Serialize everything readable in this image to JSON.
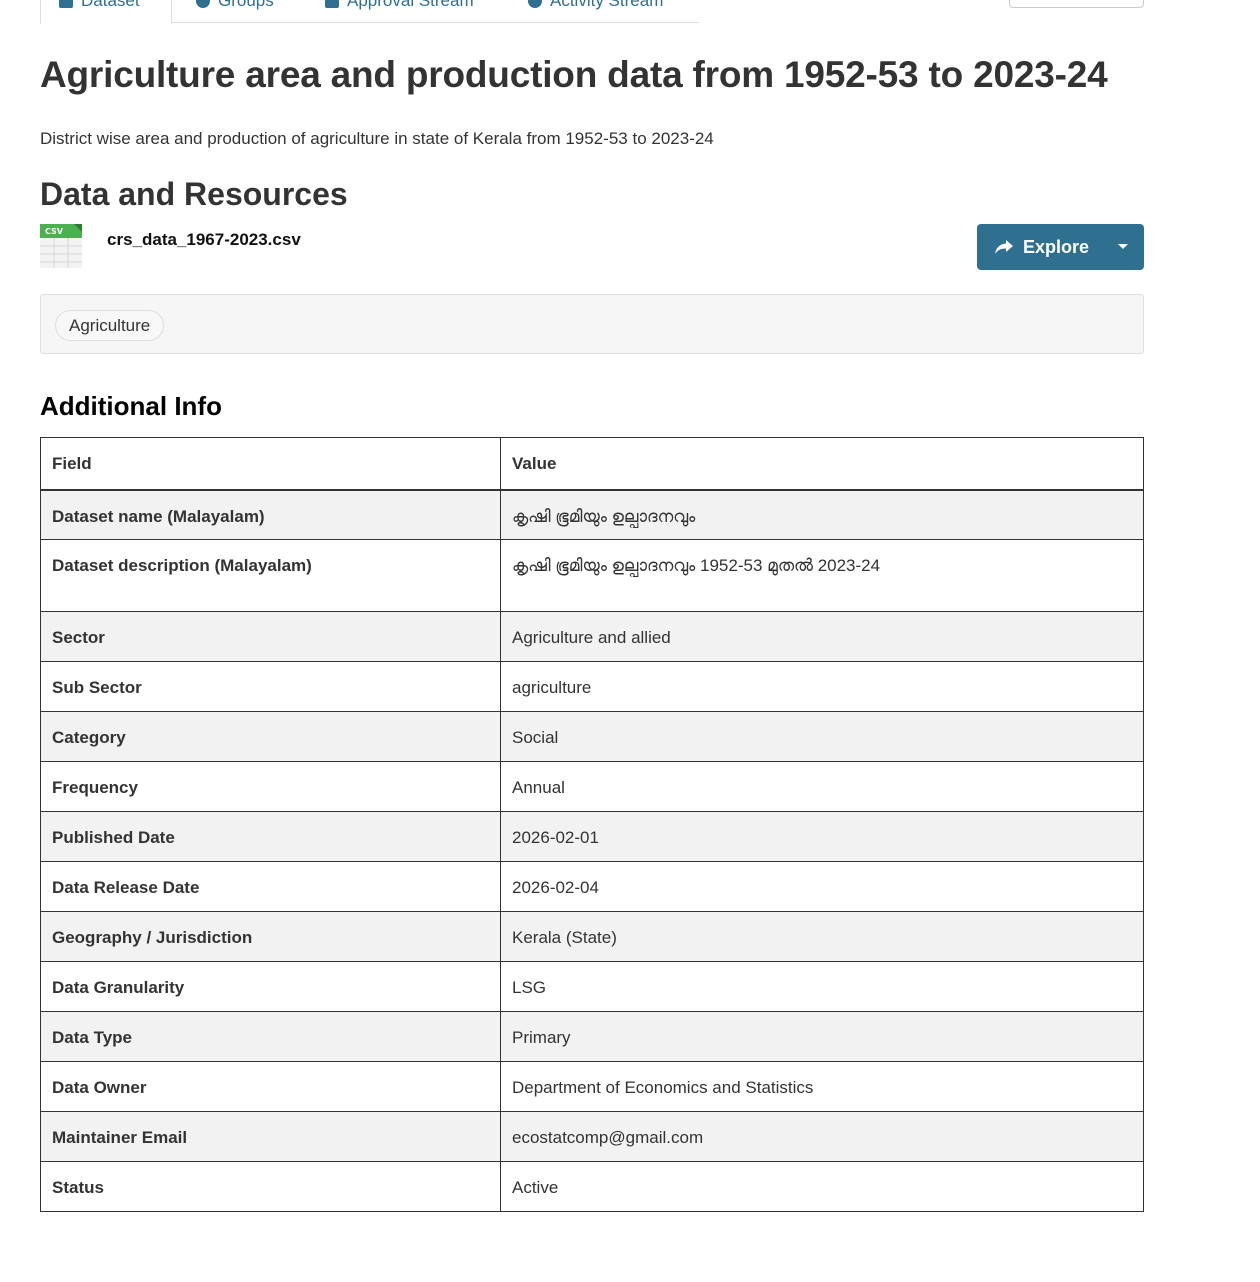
{
  "tabs": [
    {
      "label": "Dataset",
      "active": true,
      "icon": "sitemap-icon"
    },
    {
      "label": "Groups",
      "active": false,
      "icon": "users-icon"
    },
    {
      "label": "Approval Stream",
      "active": false,
      "icon": "calendar-icon"
    },
    {
      "label": "Activity Stream",
      "active": false,
      "icon": "clock-icon"
    }
  ],
  "dataset": {
    "title": "Agriculture area and production data from 1952-53 to 2023-24",
    "description": "District wise area and production of agriculture in state of Kerala from 1952-53 to 2023-24"
  },
  "resources": {
    "heading": "Data and Resources",
    "items": [
      {
        "name": "crs_data_1967-2023.csv",
        "format_badge": "CSV",
        "explore_label": "Explore"
      }
    ]
  },
  "tags": [
    "Agriculture"
  ],
  "additional_info": {
    "heading": "Additional Info",
    "columns": [
      "Field",
      "Value"
    ],
    "rows": [
      {
        "field": "Dataset name (Malayalam)",
        "value": "കൃഷി ഭൂമിയും ഉല്പാദനവും"
      },
      {
        "field": "Dataset description (Malayalam)",
        "value": "കൃഷി ഭൂമിയും ഉല്പാദനവും 1952-53 മുതൽ 2023-24"
      },
      {
        "field": "Sector",
        "value": "Agriculture and allied"
      },
      {
        "field": "Sub Sector",
        "value": "agriculture"
      },
      {
        "field": "Category",
        "value": "Social"
      },
      {
        "field": "Frequency",
        "value": "Annual"
      },
      {
        "field": "Published Date",
        "value": "2026-02-01"
      },
      {
        "field": "Data Release Date",
        "value": "2026-02-04"
      },
      {
        "field": "Geography / Jurisdiction",
        "value": "Kerala (State)"
      },
      {
        "field": "Data Granularity",
        "value": "LSG"
      },
      {
        "field": "Data Type",
        "value": "Primary"
      },
      {
        "field": "Data Owner",
        "value": "Department of Economics and Statistics"
      },
      {
        "field": "Maintainer Email",
        "value": "ecostatcomp@gmail.com"
      },
      {
        "field": "Status",
        "value": "Active"
      }
    ]
  },
  "colors": {
    "accent": "#2f6f8f",
    "csv_green": "#4caf50"
  }
}
